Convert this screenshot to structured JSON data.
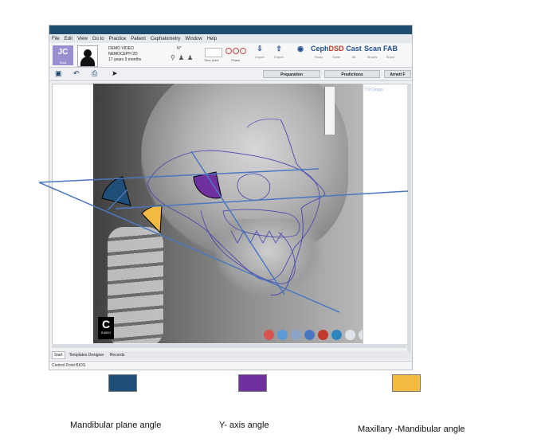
{
  "menu": [
    "File",
    "Edit",
    "View",
    "Go to",
    "Practice",
    "Patient",
    "Cephalometry",
    "Window",
    "Help"
  ],
  "patient": {
    "initials": "JC",
    "initials_sub": "Start",
    "name": "DEMO VIDEO",
    "record": "NEMOCEPH 2D",
    "age": "17 years 3 months",
    "n_value": "N°"
  },
  "toolbar": {
    "time_label": "Time point",
    "phase_label": "Phase",
    "import_label": "Import",
    "export_label": "Export",
    "buttons": [
      {
        "icon": "Ceph",
        "label": "Ceph",
        "sub": "Study"
      },
      {
        "icon": "DSD",
        "label": "DSD",
        "sub": "Smile"
      },
      {
        "icon": "Cast",
        "label": "Cast",
        "sub": "3D"
      },
      {
        "icon": "Scan",
        "label": "Scan",
        "sub": "Shoots"
      },
      {
        "icon": "FAB",
        "label": "FAB",
        "sub": "Share"
      }
    ],
    "preparation": "Preparation",
    "predictions": "Predictions",
    "arnett": "Arnett F"
  },
  "right_panel_label": "T:0 Ceogo",
  "cbadge": {
    "letter": "C",
    "sub": "B-MOO"
  },
  "tabs": [
    "Start",
    "Templates Designer",
    "Records"
  ],
  "status": "Control Point BIOS",
  "colors": {
    "mandibular_plane": "#1f4e79",
    "y_axis": "#7030a0",
    "maxillary_mandibular": "#f4b942",
    "lines": "#4a78c0",
    "tracing": "#3a3ab0"
  },
  "legend": [
    {
      "label": "Mandibular plane angle",
      "color": "#1f4e79"
    },
    {
      "label": "Y- axis angle",
      "color": "#7030a0"
    },
    {
      "label": "Maxillary -Mandibular angle",
      "color": "#f4b942"
    }
  ]
}
